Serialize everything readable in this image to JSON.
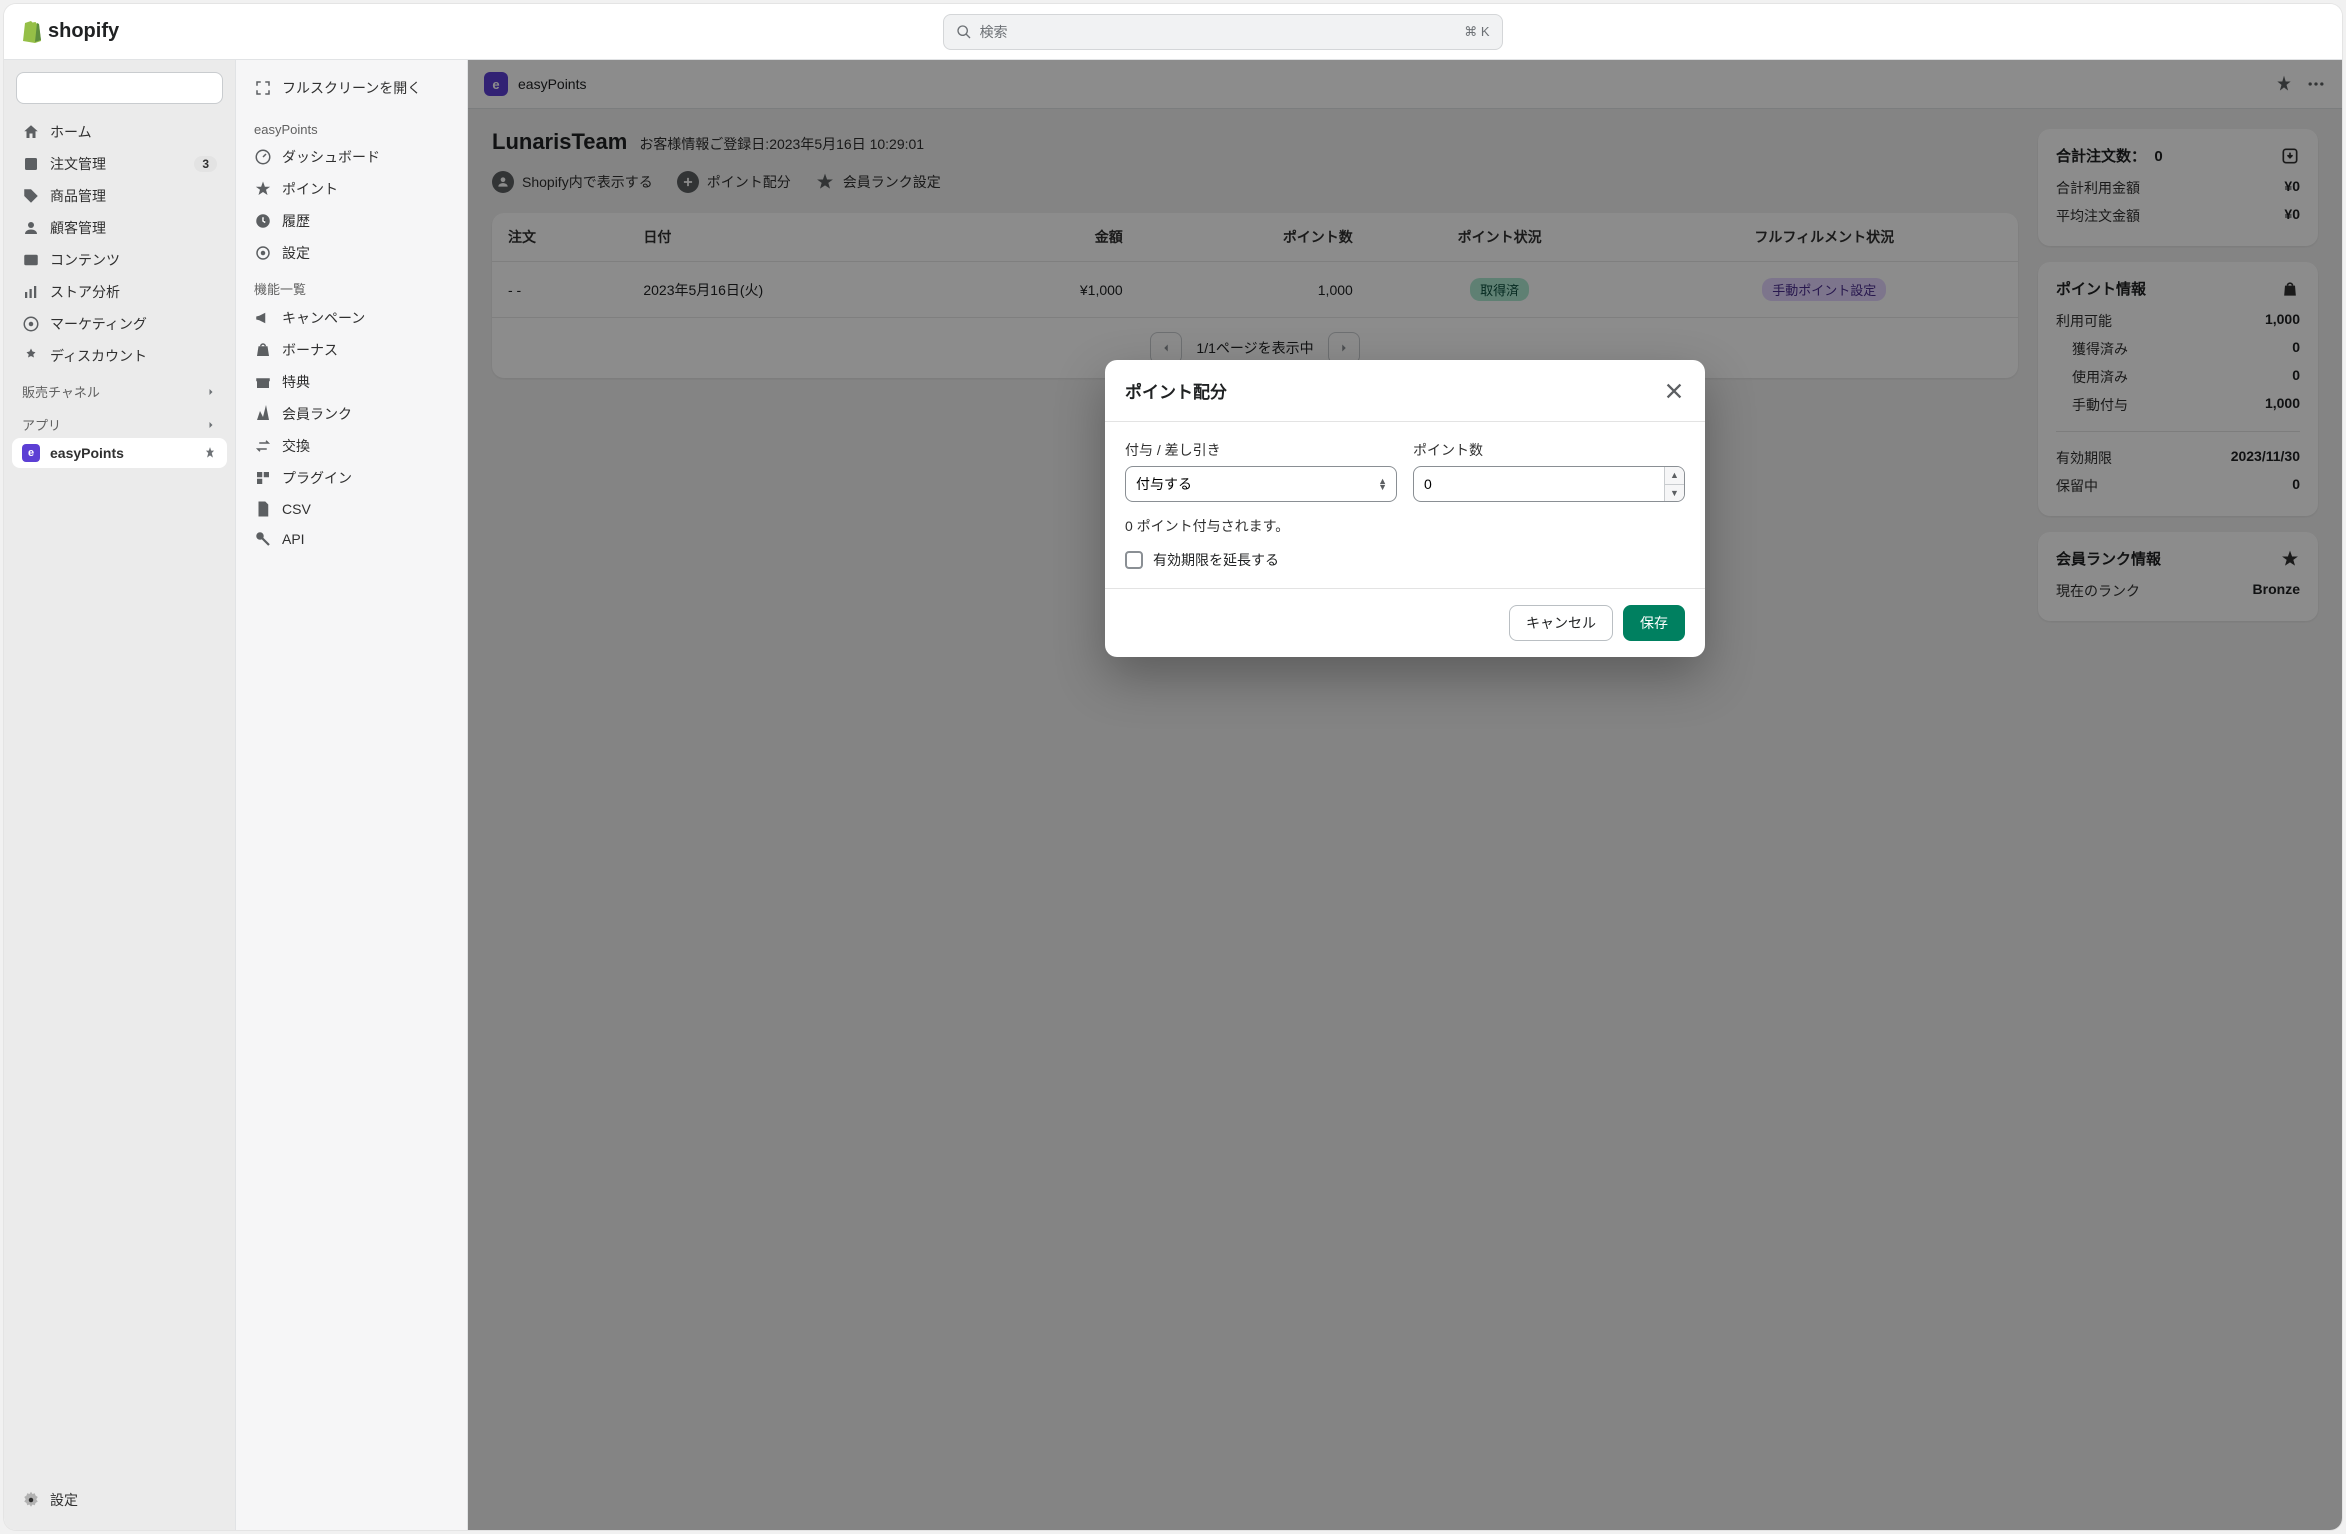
{
  "topbar": {
    "brand": "shopify",
    "search_placeholder": "検索",
    "search_shortcut": "⌘ K"
  },
  "leftnav": {
    "items": [
      {
        "label": "ホーム",
        "icon": "home"
      },
      {
        "label": "注文管理",
        "icon": "orders",
        "badge": "3"
      },
      {
        "label": "商品管理",
        "icon": "products"
      },
      {
        "label": "顧客管理",
        "icon": "customers"
      },
      {
        "label": "コンテンツ",
        "icon": "content"
      },
      {
        "label": "ストア分析",
        "icon": "analytics"
      },
      {
        "label": "マーケティング",
        "icon": "marketing"
      },
      {
        "label": "ディスカウント",
        "icon": "discounts"
      }
    ],
    "sales_channels_label": "販売チャネル",
    "apps_label": "アプリ",
    "app_item": "easyPoints",
    "settings": "設定"
  },
  "appSidebar": {
    "fullscreen": "フルスクリーンを開く",
    "section1_label": "easyPoints",
    "section1_items": [
      {
        "label": "ダッシュボード",
        "icon": "dashboard"
      },
      {
        "label": "ポイント",
        "icon": "star"
      },
      {
        "label": "履歴",
        "icon": "clock"
      },
      {
        "label": "設定",
        "icon": "gear"
      }
    ],
    "section2_label": "機能一覧",
    "section2_items": [
      {
        "label": "キャンペーン",
        "icon": "megaphone"
      },
      {
        "label": "ボーナス",
        "icon": "bag"
      },
      {
        "label": "特典",
        "icon": "gift"
      },
      {
        "label": "会員ランク",
        "icon": "rank"
      },
      {
        "label": "交換",
        "icon": "swap"
      },
      {
        "label": "プラグイン",
        "icon": "plugin"
      },
      {
        "label": "CSV",
        "icon": "file"
      },
      {
        "label": "API",
        "icon": "key"
      }
    ]
  },
  "appHeader": {
    "name": "easyPoints"
  },
  "page": {
    "title": "LunarisTeam",
    "subtitle": "お客様情報ご登録日:2023年5月16日 10:29:01",
    "actions": {
      "view_in_shopify": "Shopify内で表示する",
      "point_allocation": "ポイント配分",
      "rank_settings": "会員ランク設定"
    }
  },
  "table": {
    "headers": {
      "order": "注文",
      "date": "日付",
      "amount": "金額",
      "points": "ポイント数",
      "point_status": "ポイント状況",
      "fulfillment": "フルフィルメント状況"
    },
    "rows": [
      {
        "order": "- -",
        "date": "2023年5月16日(火)",
        "amount": "¥1,000",
        "points": "1,000",
        "point_status": "取得済",
        "fulfillment": "手動ポイント設定"
      }
    ],
    "pagination_text": "1/1ページを表示中"
  },
  "summary": {
    "total_orders_label": "合計注文数：",
    "total_orders_value": "0",
    "total_used_label": "合計利用金額",
    "total_used_value": "¥0",
    "avg_order_label": "平均注文金額",
    "avg_order_value": "¥0"
  },
  "points_info": {
    "title": "ポイント情報",
    "available_label": "利用可能",
    "available_value": "1,000",
    "earned_label": "獲得済み",
    "earned_value": "0",
    "used_label": "使用済み",
    "used_value": "0",
    "manual_label": "手動付与",
    "manual_value": "1,000",
    "expiry_label": "有効期限",
    "expiry_value": "2023/11/30",
    "pending_label": "保留中",
    "pending_value": "0"
  },
  "rank_info": {
    "title": "会員ランク情報",
    "current_label": "現在のランク",
    "current_value": "Bronze"
  },
  "modal": {
    "title": "ポイント配分",
    "grant_label": "付与 / 差し引き",
    "grant_value": "付与する",
    "points_label": "ポイント数",
    "points_value": "0",
    "help_text": "0 ポイント付与されます。",
    "checkbox_label": "有効期限を延長する",
    "cancel": "キャンセル",
    "save": "保存"
  }
}
